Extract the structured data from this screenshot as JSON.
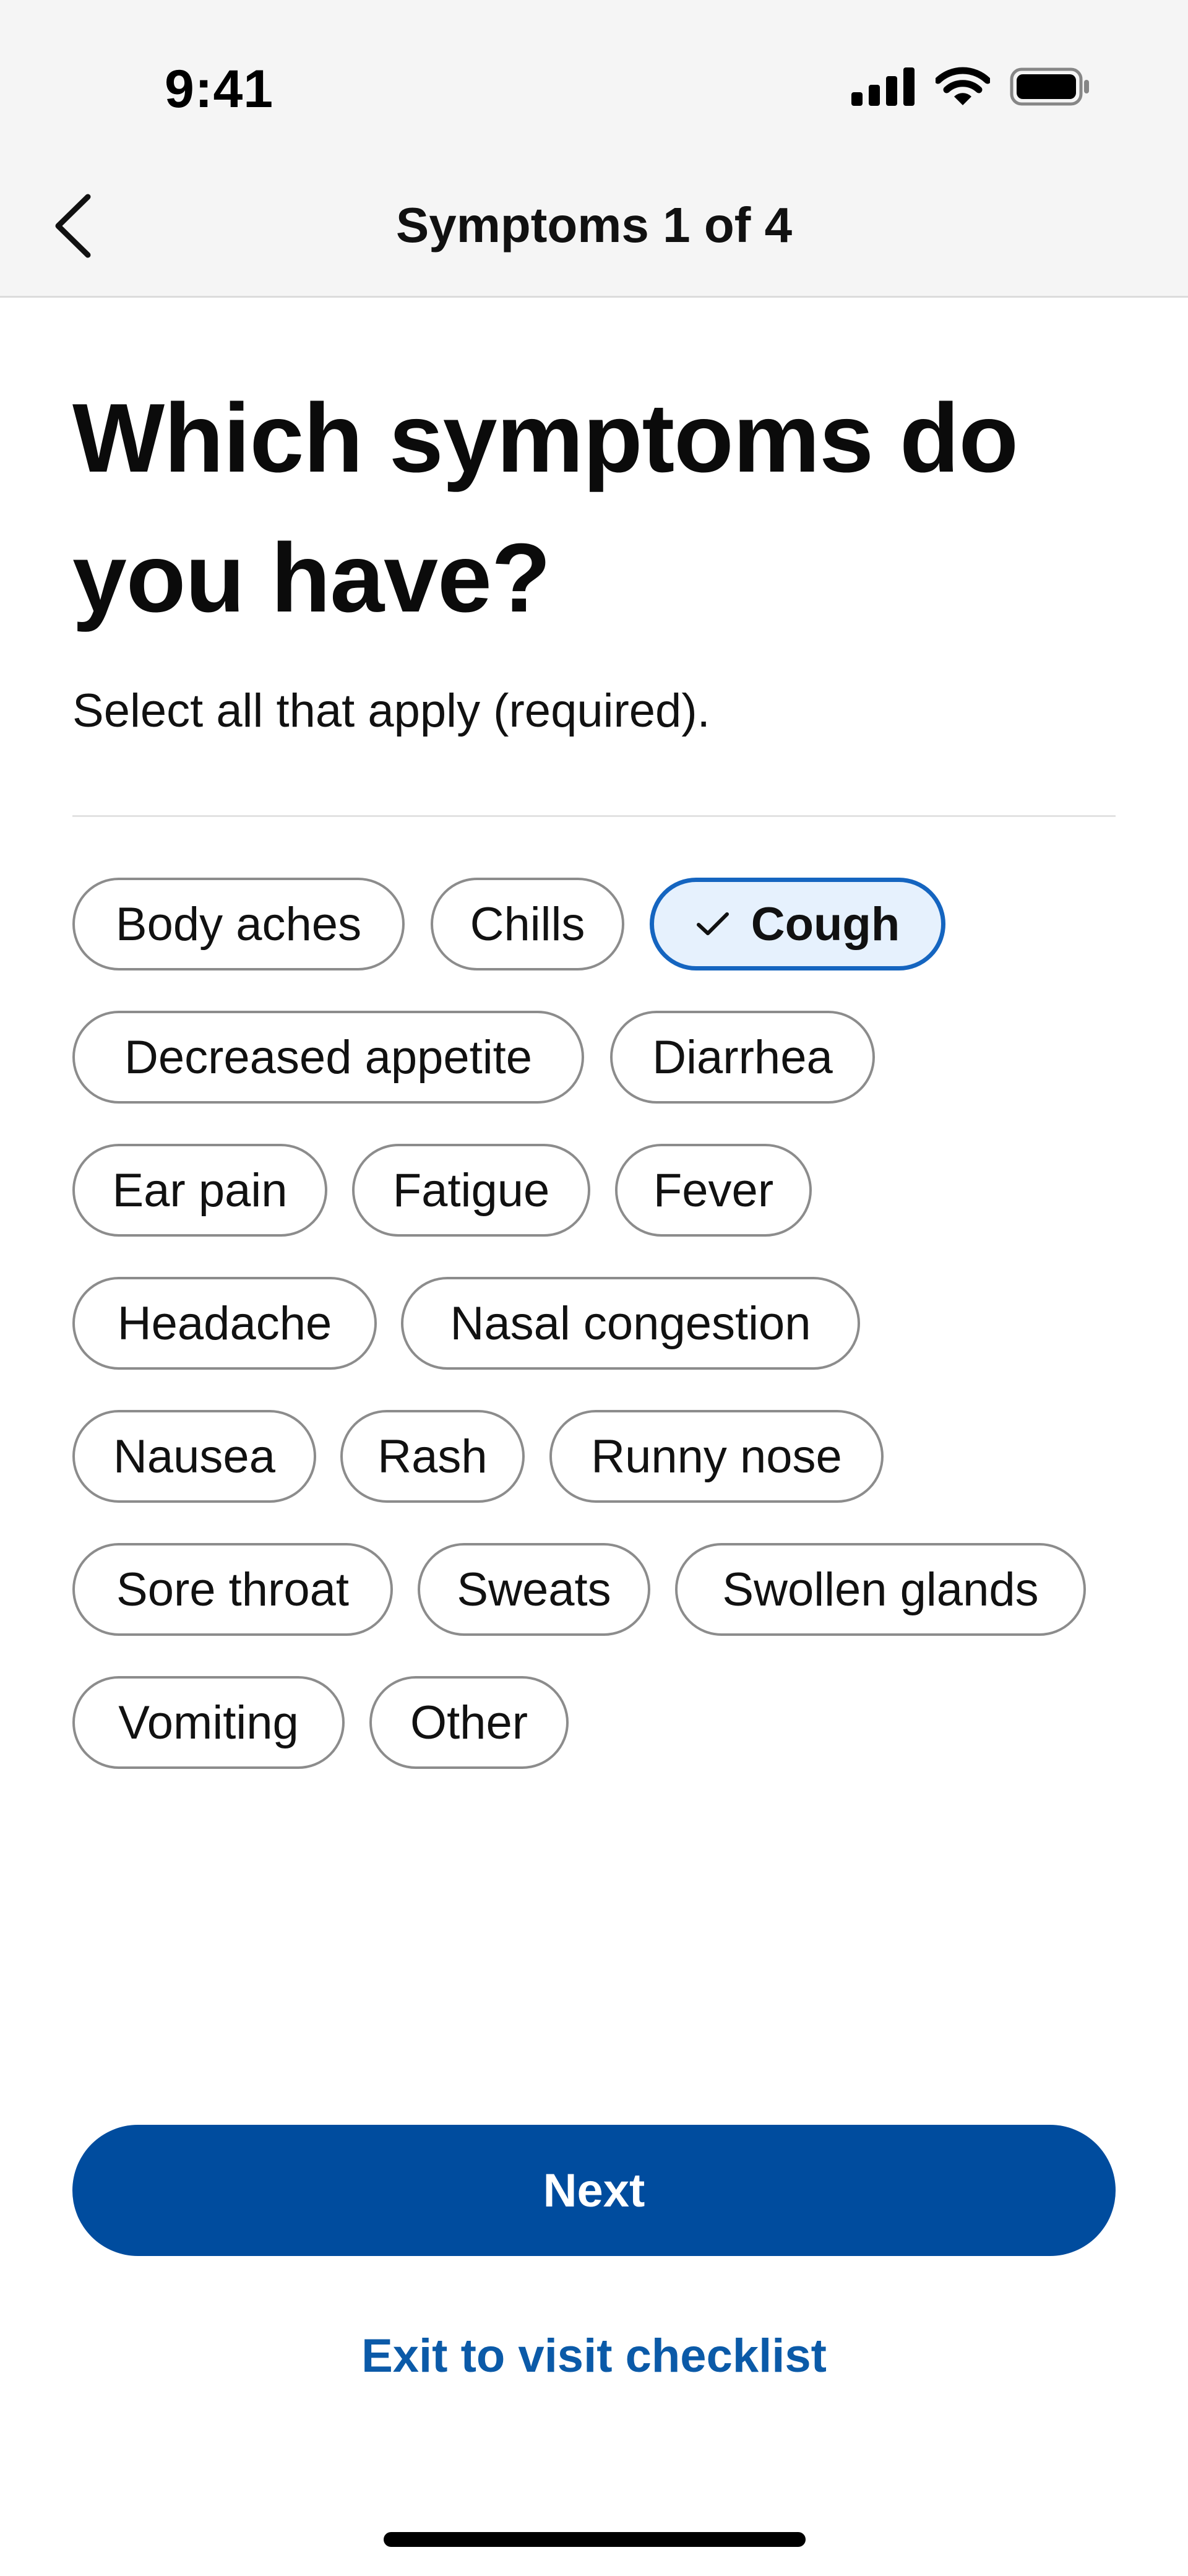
{
  "status_bar": {
    "time": "9:41",
    "signal_icon": "cellular-signal-icon",
    "wifi_icon": "wifi-icon",
    "battery_icon": "battery-icon"
  },
  "nav": {
    "back_icon": "chevron-left-icon",
    "title": "Symptoms 1 of 4"
  },
  "question": {
    "heading": "Which symptoms do you have?",
    "instruction": "Select all that apply (required)."
  },
  "symptoms": {
    "check_icon": "checkmark-icon",
    "options": [
      {
        "label": "Body aches",
        "selected": false
      },
      {
        "label": "Chills",
        "selected": false
      },
      {
        "label": "Cough",
        "selected": true
      },
      {
        "label": "Decreased appetite",
        "selected": false
      },
      {
        "label": "Diarrhea",
        "selected": false
      },
      {
        "label": "Ear pain",
        "selected": false
      },
      {
        "label": "Fatigue",
        "selected": false
      },
      {
        "label": "Fever",
        "selected": false
      },
      {
        "label": "Headache",
        "selected": false
      },
      {
        "label": "Nasal congestion",
        "selected": false
      },
      {
        "label": "Nausea",
        "selected": false
      },
      {
        "label": "Rash",
        "selected": false
      },
      {
        "label": "Runny nose",
        "selected": false
      },
      {
        "label": "Sore throat",
        "selected": false
      },
      {
        "label": "Sweats",
        "selected": false
      },
      {
        "label": "Swollen glands",
        "selected": false
      },
      {
        "label": "Vomiting",
        "selected": false
      },
      {
        "label": "Other",
        "selected": false
      }
    ]
  },
  "actions": {
    "next_label": "Next",
    "exit_label": "Exit to visit checklist"
  },
  "colors": {
    "primary": "#004c9e",
    "link": "#0b5aa8",
    "selected_border": "#1565c0",
    "selected_fill": "#e6f1fd",
    "chip_border": "#8c8c8c",
    "header_bg": "#f5f5f5"
  }
}
